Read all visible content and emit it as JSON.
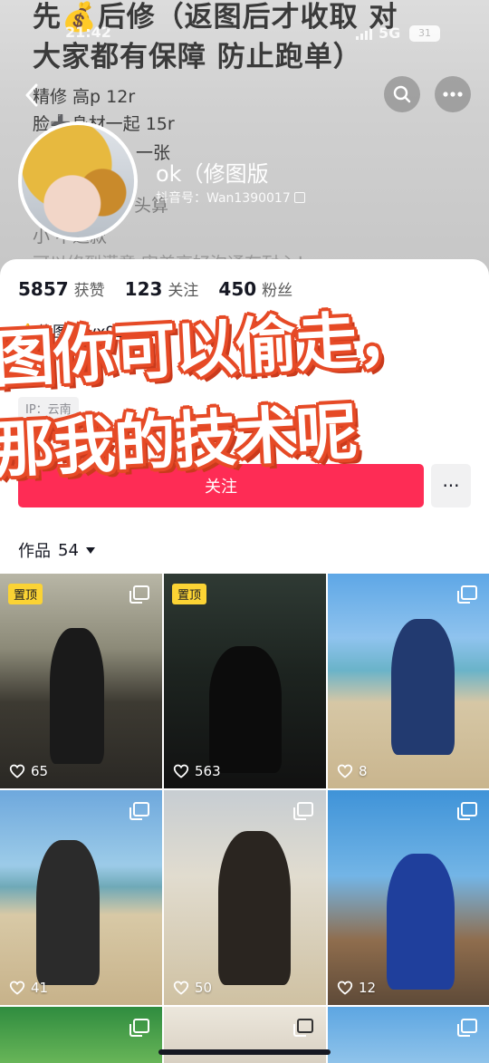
{
  "status_bar": {
    "time": "21:42",
    "network": "5G",
    "battery": "31"
  },
  "bio_background": {
    "title_line1": "先💰后修（返图后才收取 对",
    "title_line2": "大家都有保障 防止跑单）",
    "line1": "精修 高p 12r",
    "line2": "脸➕身材一起 15r",
    "line3": "一张",
    "line4": "头算",
    "line5": "小 不退款",
    "line6": "可以修到满意 审美高好沟通有耐心！"
  },
  "profile": {
    "nickname": "ok（修图版",
    "douyin_id": "抖音号：Wan1390017"
  },
  "stats": [
    {
      "value": "5857",
      "label": "获赞"
    },
    {
      "value": "123",
      "label": "关注"
    },
    {
      "value": "450",
      "label": "粉丝"
    }
  ],
  "bio": {
    "row1": "⚠️修图➕vx9290",
    "row2": "",
    "row3": "",
    "ip": "IP：云南"
  },
  "actions": {
    "follow": "关注",
    "more": "···"
  },
  "overlay": {
    "line1": "图你可以偷走，",
    "line2": "那我的技术呢"
  },
  "works_tab": {
    "label": "作品",
    "count": "54"
  },
  "grid": [
    {
      "pinned": "置顶",
      "likes": "65"
    },
    {
      "pinned": "置顶",
      "likes": "563"
    },
    {
      "pinned": "",
      "likes": "8"
    },
    {
      "pinned": "",
      "likes": "41"
    },
    {
      "pinned": "",
      "likes": "50"
    },
    {
      "pinned": "",
      "likes": "12"
    }
  ]
}
